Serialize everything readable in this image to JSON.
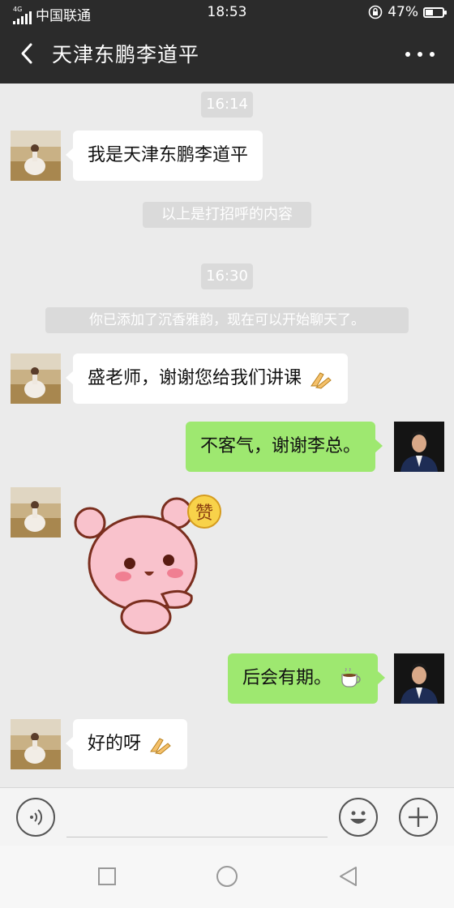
{
  "status_bar": {
    "network_type": "4G",
    "carrier": "中国联通",
    "time": "18:53",
    "battery": "47%",
    "battery_level": 0.47
  },
  "header": {
    "title": "天津东鹏李道平"
  },
  "messages": {
    "time1": "16:14",
    "msg1": "我是天津东鹏李道平",
    "system1": "以上是打招呼的内容",
    "time2": "16:30",
    "system2": "你已添加了沉香雅韵，现在可以开始聊天了。",
    "msg2": "盛老师，谢谢您给我们讲课",
    "msg3": "不客气，谢谢李总。",
    "sticker_label": "赞",
    "msg4": "后会有期。",
    "msg5": "好的呀"
  },
  "icons": {
    "back": "chevron-left-icon",
    "more": "more-dots-icon",
    "clap": "clap-emoji-icon",
    "coffee": "coffee-emoji-icon",
    "voice": "voice-icon",
    "emoji": "smiley-icon",
    "plus": "plus-icon",
    "nav_square": "recent-apps-icon",
    "nav_circle": "home-icon",
    "nav_back": "nav-back-icon"
  },
  "colors": {
    "header_bg": "#2b2b2b",
    "chat_bg": "#ebebeb",
    "incoming_bubble": "#ffffff",
    "outgoing_bubble": "#9ee870",
    "system_pill": "#dadada"
  }
}
